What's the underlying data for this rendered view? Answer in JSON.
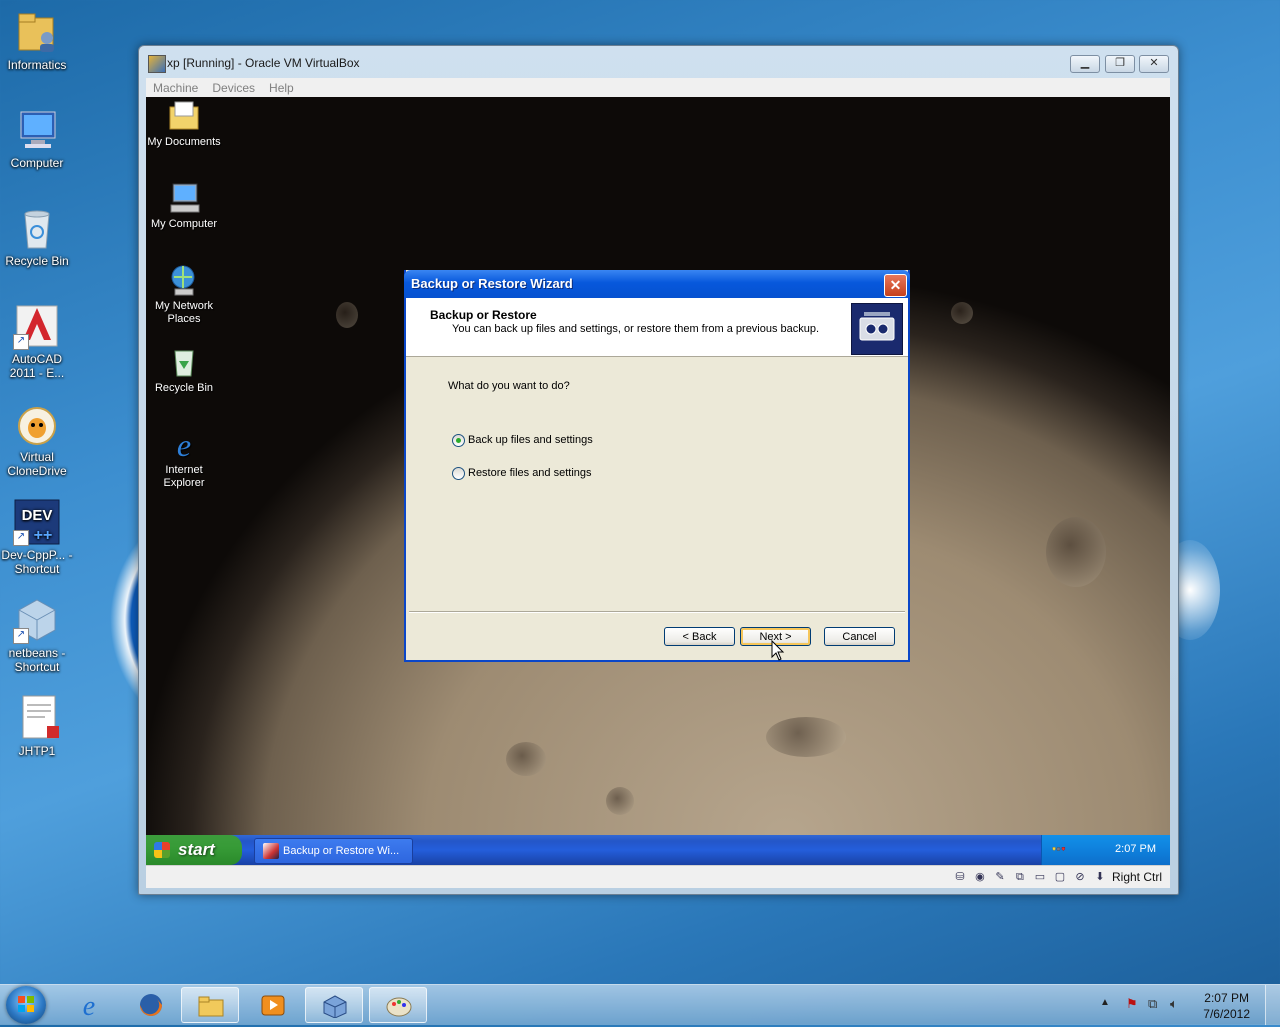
{
  "host_desktop": {
    "icons": [
      {
        "label": "Informatics"
      },
      {
        "label": "Computer"
      },
      {
        "label": "Recycle Bin"
      },
      {
        "label": "AutoCAD 2011 - E..."
      },
      {
        "label": "Virtual CloneDrive"
      },
      {
        "label": "Dev-CppP... - Shortcut"
      },
      {
        "label": "netbeans - Shortcut"
      },
      {
        "label": "JHTP1"
      }
    ]
  },
  "vbox": {
    "title": "xp [Running] - Oracle VM VirtualBox",
    "menu": [
      "Machine",
      "Devices",
      "Help"
    ],
    "status_right_ctrl": "Right Ctrl"
  },
  "guest_desktop": {
    "icons": [
      {
        "label": "My Documents"
      },
      {
        "label": "My Computer"
      },
      {
        "label": "My Network Places"
      },
      {
        "label": "Recycle Bin"
      },
      {
        "label": "Internet Explorer"
      }
    ]
  },
  "dialog": {
    "title": "Backup or Restore Wizard",
    "close_glyph": "✕",
    "header_title": "Backup or Restore",
    "header_subtitle": "You can back up files and settings, or restore them from a previous backup.",
    "question": "What do you want to do?",
    "options": [
      {
        "label": "Back up files and settings",
        "selected": true
      },
      {
        "label": "Restore files and settings",
        "selected": false
      }
    ],
    "buttons": {
      "back": "< Back",
      "next": "Next >",
      "cancel": "Cancel"
    }
  },
  "xp_taskbar": {
    "start_label": "start",
    "task_label": "Backup or Restore Wi...",
    "clock": "2:07 PM"
  },
  "win7_taskbar": {
    "clock_time": "2:07 PM",
    "clock_date": "7/6/2012",
    "apps": [
      "internet-explorer-icon",
      "firefox-icon",
      "folder-icon",
      "media-player-icon",
      "virtualbox-icon",
      "paint-icon"
    ]
  }
}
